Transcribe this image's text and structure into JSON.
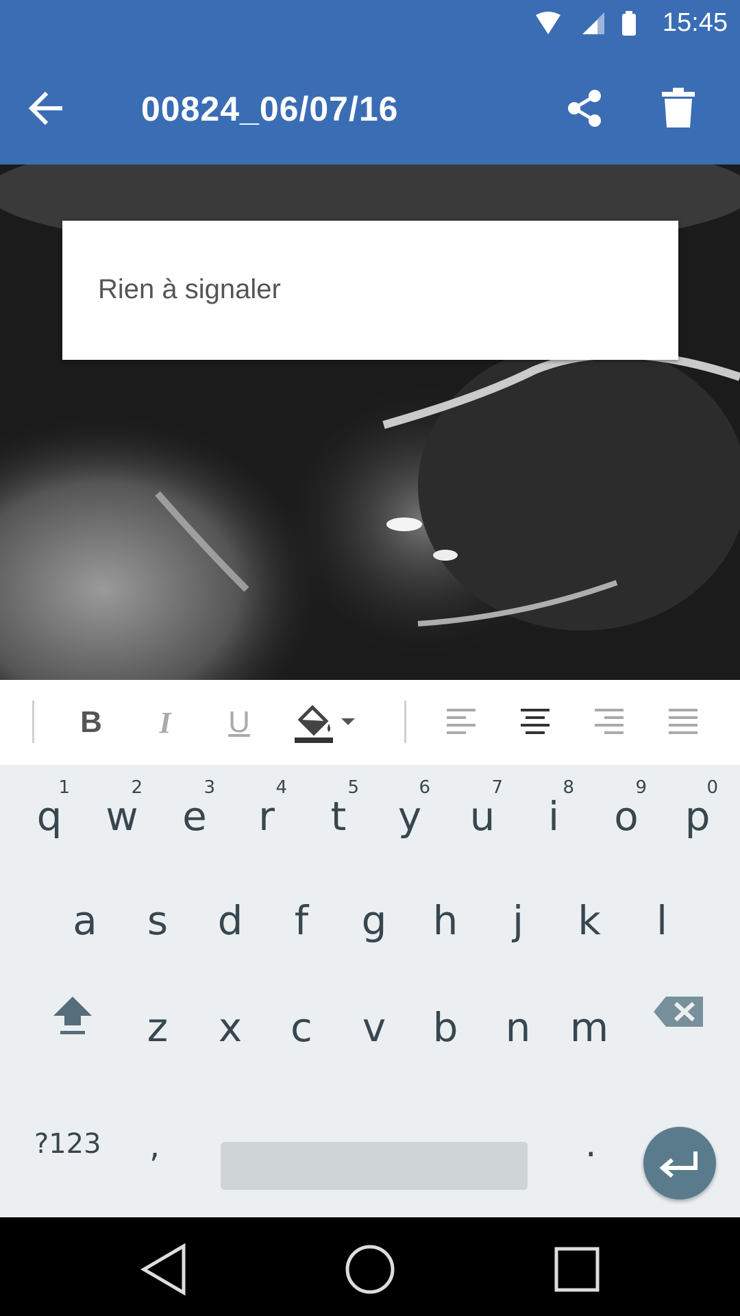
{
  "status": {
    "time": "15:45"
  },
  "appbar": {
    "title": "00824_06/07/16"
  },
  "note": {
    "text": "Rien à signaler"
  },
  "toolbar": {
    "bold_label": "B",
    "italic_label": "I",
    "underline_label": "U"
  },
  "keyboard": {
    "row1": [
      {
        "key": "q",
        "hint": "1"
      },
      {
        "key": "w",
        "hint": "2"
      },
      {
        "key": "e",
        "hint": "3"
      },
      {
        "key": "r",
        "hint": "4"
      },
      {
        "key": "t",
        "hint": "5"
      },
      {
        "key": "y",
        "hint": "6"
      },
      {
        "key": "u",
        "hint": "7"
      },
      {
        "key": "i",
        "hint": "8"
      },
      {
        "key": "o",
        "hint": "9"
      },
      {
        "key": "p",
        "hint": "0"
      }
    ],
    "row2": [
      "a",
      "s",
      "d",
      "f",
      "g",
      "h",
      "j",
      "k",
      "l"
    ],
    "row3": [
      "z",
      "x",
      "c",
      "v",
      "b",
      "n",
      "m"
    ],
    "symbols_label": "?123",
    "comma_label": ",",
    "period_label": "."
  },
  "colors": {
    "primary": "#3b6db5",
    "keyboard_bg": "#eceff1",
    "key_text": "#37474f",
    "enter_button": "#5a7b8c"
  },
  "icons": {
    "back": "arrow-left-icon",
    "share": "share-icon",
    "delete": "trash-icon",
    "fill_color": "paint-bucket-icon",
    "align_left": "align-left-icon",
    "align_center": "align-center-icon",
    "align_right": "align-right-icon",
    "align_justify": "align-justify-icon",
    "shift": "shift-icon",
    "backspace": "backspace-icon",
    "enter": "enter-icon"
  }
}
